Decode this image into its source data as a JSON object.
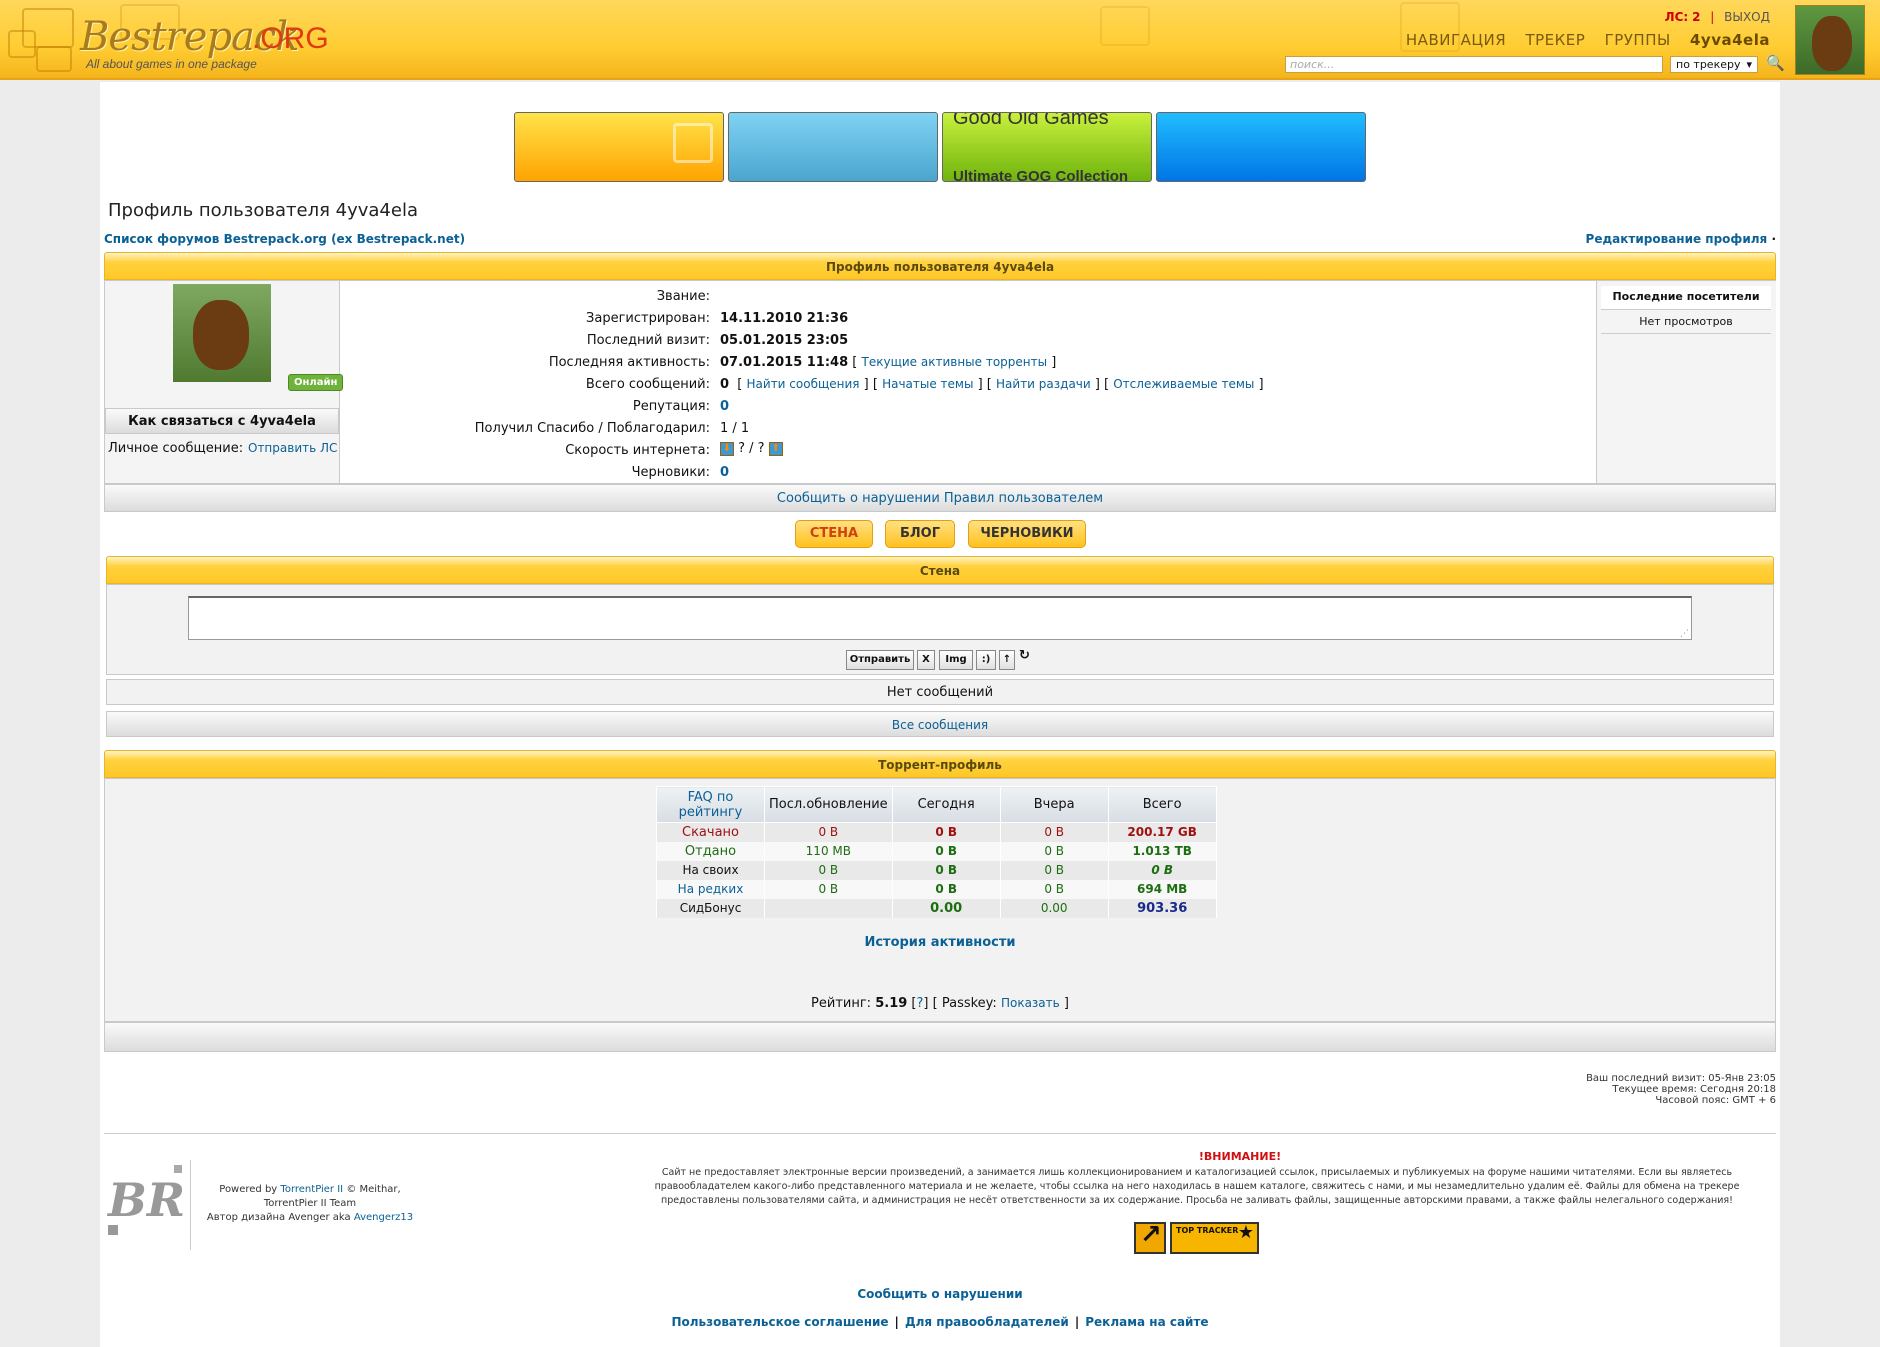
{
  "header": {
    "logo_text": "Bestrepack",
    "logo_org": ".ORG",
    "tagline": "All about games in one package",
    "pm_label": "ЛС:",
    "pm_count": "2",
    "sep": "|",
    "logout": "ВЫХОД",
    "nav": [
      "НАВИГАЦИЯ",
      "ТРЕКЕР",
      "ГРУППЫ"
    ],
    "username": "4yva4ela",
    "search_placeholder": "поиск...",
    "search_scope": "по трекеру"
  },
  "banners": {
    "gog_title": "Good Old Games",
    "gog_sub": "Ultimate GOG Collection"
  },
  "page": {
    "title": "Профиль пользователя 4yva4ela",
    "breadcrumb": "Список форумов Bestrepack.org (ex Bestrepack.net)",
    "edit_profile": "Редактирование профиля",
    "edit_sep": "·"
  },
  "profile": {
    "bar_title": "Профиль пользователя 4yva4ela",
    "online_badge": "Онлайн",
    "contact_header": "Как связаться с 4yva4ela",
    "pm_label": "Личное сообщение:",
    "pm_link": "Отправить ЛС",
    "fields": {
      "rank_label": "Звание:",
      "registered_label": "Зарегистрирован:",
      "registered": "14.11.2010 21:36",
      "last_visit_label": "Последний визит:",
      "last_visit": "05.01.2015 23:05",
      "last_activity_label": "Последняя активность:",
      "last_activity": "07.01.2015 11:48",
      "active_torrents": "Текущие активные торренты",
      "posts_label": "Всего сообщений:",
      "posts": "0",
      "find_posts": "Найти сообщения",
      "started_topics": "Начатые темы",
      "find_releases": "Найти раздачи",
      "watched_topics": "Отслеживаемые темы",
      "reputation_label": "Репутация:",
      "reputation": "0",
      "thanks_label": "Получил Спасибо / Поблагодарил:",
      "thanks": "1 / 1",
      "speed_label": "Скорость интернета:",
      "speed": "? / ?",
      "drafts_label": "Черновики:",
      "drafts": "0"
    },
    "visitors_header": "Последние посетители",
    "visitors_none": "Нет просмотров",
    "report_rules": "Сообщить о нарушении Правил пользователем"
  },
  "tabs": [
    "СТЕНА",
    "БЛОГ",
    "ЧЕРНОВИКИ"
  ],
  "wall": {
    "title": "Стена",
    "buttons": [
      "Отправить",
      "X",
      "Img",
      ":)",
      "↑"
    ],
    "refresh_icon": "refresh-icon",
    "no_messages": "Нет сообщений",
    "all_messages": "Все сообщения"
  },
  "torrent": {
    "title": "Торрент-профиль",
    "columns": [
      "FAQ по рейтингу",
      "Посл.обновление",
      "Сегодня",
      "Вчера",
      "Всего"
    ],
    "rows": [
      [
        "Скачано",
        "0 B",
        "0 B",
        "0 B",
        "200.17 GB"
      ],
      [
        "Отдано",
        "110 MB",
        "0 B",
        "0 B",
        "1.013 TB"
      ],
      [
        "На своих",
        "0 B",
        "0 B",
        "0 B",
        "0 B"
      ],
      [
        "На редких",
        "0 B",
        "0 B",
        "0 B",
        "694 MB"
      ],
      [
        "СидБонус",
        "",
        "0.00",
        "0.00",
        "903.36"
      ]
    ],
    "history": "История активности",
    "rating_label": "Рейтинг:",
    "rating": "5.19",
    "rating_help": "?",
    "passkey_label": "Passkey:",
    "passkey_show": "Показать"
  },
  "footer": {
    "last_visit": "Ваш последний визит: 05-Янв 23:05",
    "current_time": "Текущее время: Сегодня 20:18",
    "timezone": "Часовой пояс: GMT + 6",
    "powered_1": "Powered by",
    "powered_link": "TorrentPier II",
    "powered_2": "© Meithar,",
    "powered_3": "TorrentPier II Team",
    "design_1": "Автор дизайна Avenger aka",
    "design_link": "Avengerz13",
    "warning": "!ВНИМАНИЕ!",
    "disclaimer": "Сайт не предоставляет электронные версии произведений, а занимается лишь коллекционированием и каталогизацией ссылок, присылаемых и публикуемых на форуме нашими читателями. Если вы являетесь правообладателем какого-либо представленного материала и не желаете, чтобы ссылка на него находилась в нашем каталоге, свяжитесь с нами, и мы незамедлительно удалим её. Файлы для обмена на трекере предоставлены пользователями сайта, и администрация не несёт ответственности за их содержание. Просьба не заливать файлы, защищенные авторскими правами, а также файлы нелегального содержания!",
    "counter_text": "TOP TRACKER",
    "report": "Сообщить о нарушении",
    "links": [
      "Пользовательское соглашение",
      "Для правообладателей",
      "Реклама на сайте"
    ]
  }
}
